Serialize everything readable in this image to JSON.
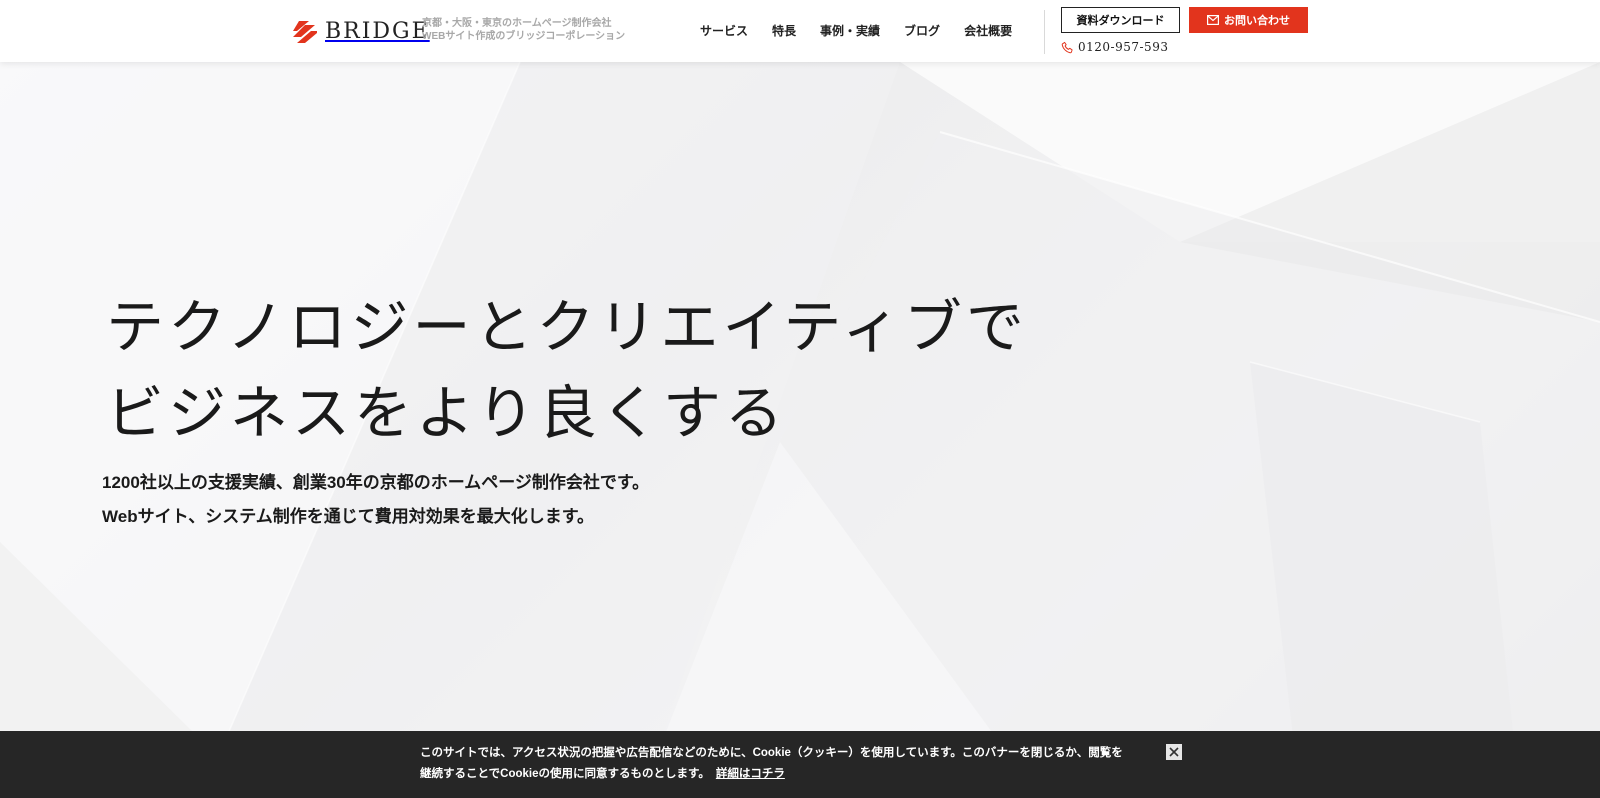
{
  "header": {
    "logo_text": "BRIDGE",
    "tagline_line1": "京都・大阪・東京のホームページ制作会社",
    "tagline_line2": "WEBサイト作成のブリッジコーポレーション",
    "nav": [
      {
        "label": "サービス"
      },
      {
        "label": "特長"
      },
      {
        "label": "事例・実績"
      },
      {
        "label": "ブログ"
      },
      {
        "label": "会社概要"
      }
    ],
    "download_label": "資料ダウンロード",
    "contact_label": "お問い合わせ",
    "phone": "0120-957-593",
    "icons": {
      "logo": "bridge-logo-icon",
      "contact": "mail-icon",
      "phone": "phone-icon"
    }
  },
  "hero": {
    "headline_line1": "テクノロジーとクリエイティブで",
    "headline_line2": "ビジネスをより良くする",
    "sub_line1": "1200社以上の支援実績、創業30年の京都のホームページ制作会社です。",
    "sub_line2": "Webサイト、システム制作を通じて費用対効果を最大化します。"
  },
  "cookie": {
    "line1": "このサイトでは、アクセス状況の把握や広告配信などのために、Cookie（クッキー）を使用しています。このバナーを閉じるか、閲覧を",
    "line2": "継続することでCookieの使用に同意するものとします。",
    "link_label": "詳細はコチラ",
    "close_icon": "close-icon"
  },
  "colors": {
    "accent": "#e2341d",
    "banner_bg": "#262626",
    "text": "#1a1a1a"
  }
}
